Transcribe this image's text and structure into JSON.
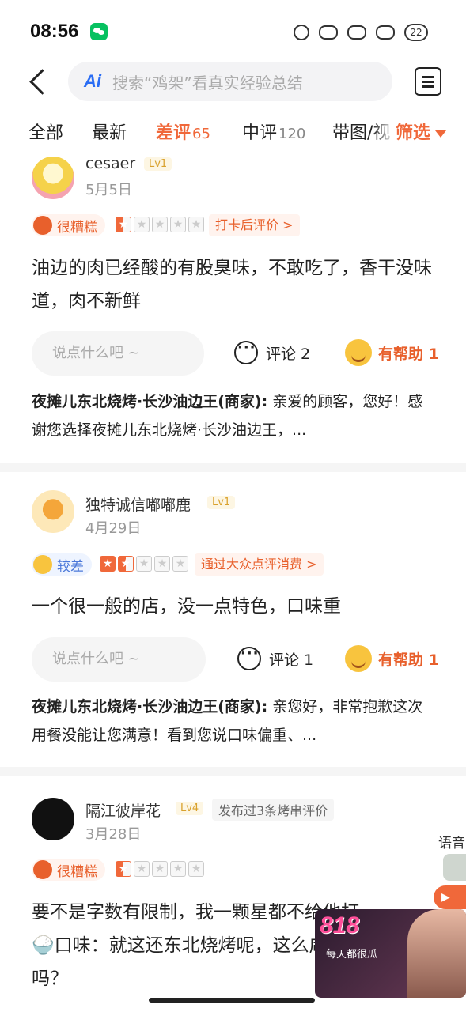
{
  "status_bar": {
    "time": "08:56",
    "battery": "22"
  },
  "search": {
    "placeholder": "搜索“鸡架”看真实经验总结",
    "ai_label": "Ai"
  },
  "tabs": [
    {
      "label": "全部",
      "count": ""
    },
    {
      "label": "最新",
      "count": ""
    },
    {
      "label": "差评",
      "count": "65"
    },
    {
      "label": "中评",
      "count": "120"
    },
    {
      "label": "带图/视",
      "count": ""
    }
  ],
  "filter_label": "筛选",
  "reviews": [
    {
      "username": "cesaer",
      "level": "Lv1",
      "date": "5月5日",
      "mood": "很糟糕",
      "stars": 0.5,
      "source": "打卡后评价 >",
      "content": "油边的肉已经酸的有股臭味，不敢吃了，香干没味道，肉不新鲜",
      "comment_placeholder": "说点什么吧 ~",
      "comment_label": "评论 2",
      "helpful_label": "有帮助 1",
      "reply_name": "夜摊儿东北烧烤·长沙油边王(商家):",
      "reply_text": " 亲爱的顾客，您好！感谢您选择夜摊儿东北烧烤·长沙油边王，..."
    },
    {
      "username": "独特诚信嘟嘟鹿",
      "level": "Lv1",
      "date": "4月29日",
      "mood": "较差",
      "stars": 1.5,
      "source": "通过大众点评消费 >",
      "content": "一个很一般的店，没一点特色，口味重",
      "comment_placeholder": "说点什么吧 ~",
      "comment_label": "评论 1",
      "helpful_label": "有帮助 1",
      "reply_name": "夜摊儿东北烧烤·长沙油边王(商家):",
      "reply_text": " 亲您好，非常抱歉这次用餐没能让您满意！看到您说口味偏重、..."
    },
    {
      "username": "隔江彼岸花",
      "level": "Lv4",
      "extra": "发布过3条烤串评价",
      "date": "3月28日",
      "mood": "很糟糕",
      "stars": 0.5,
      "content_line1": "要不是字数有限制，我一颗星都不给他打",
      "content_line2": "🍚口味：就这还东北烧烤呢，这么咸哦喷",
      "content_line3": "吗？"
    }
  ],
  "floating": {
    "voice_label": "语音"
  },
  "ad": {
    "title": "818",
    "subtitle": "每天都很瓜"
  },
  "colors": {
    "accent": "#f0683a",
    "blue": "#4b78d9"
  }
}
